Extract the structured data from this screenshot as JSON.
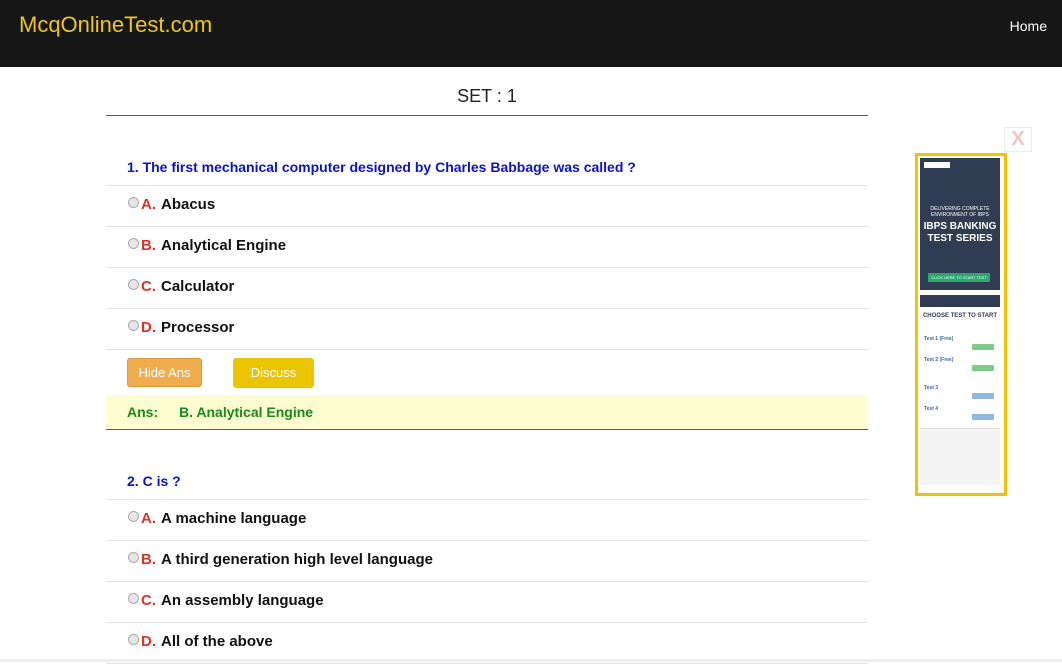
{
  "header": {
    "brand": "McqOnlineTest.com",
    "nav_home": "Home",
    "colors": {
      "background": "#161616",
      "brand": "#f0c419"
    }
  },
  "set_title": "SET : 1",
  "questions": [
    {
      "text": "1. The first mechanical computer designed by Charles Babbage was called ?",
      "options": [
        {
          "letter": "A.",
          "text": "Abacus"
        },
        {
          "letter": "B.",
          "text": "Analytical Engine"
        },
        {
          "letter": "C.",
          "text": "Calculator"
        },
        {
          "letter": "D.",
          "text": "Processor"
        }
      ],
      "hide_ans_label": "Hide Ans",
      "discuss_label": "Discuss",
      "answer_label": "Ans:",
      "answer_value": "B. Analytical Engine"
    },
    {
      "text": "2. C is ?",
      "options": [
        {
          "letter": "A.",
          "text": "A machine language"
        },
        {
          "letter": "B.",
          "text": "A third generation high level language"
        },
        {
          "letter": "C.",
          "text": "An assembly language"
        },
        {
          "letter": "D.",
          "text": "All of the above"
        }
      ]
    }
  ],
  "ad": {
    "close_label": "X",
    "tagline": "DELIVERING COMPLETE ENVIRONMENT OF IBPS",
    "headline": "IBPS BANKING TEST SERIES",
    "cta": "CLICK HERE TO START TEST",
    "choose": "CHOOSE TEST TO START",
    "tests": [
      "Test 1 (Free)",
      "Test 2 (Free)",
      "Test 3",
      "Test 4"
    ]
  },
  "colors": {
    "question": "#0b13c9",
    "option_letter": "#d9342b",
    "answer_text": "#1a8a1a",
    "answer_bg": "#fefdd1",
    "hide_button": "#efad4e",
    "discuss_button": "#ebc500",
    "ad_border": "#f3c200"
  }
}
